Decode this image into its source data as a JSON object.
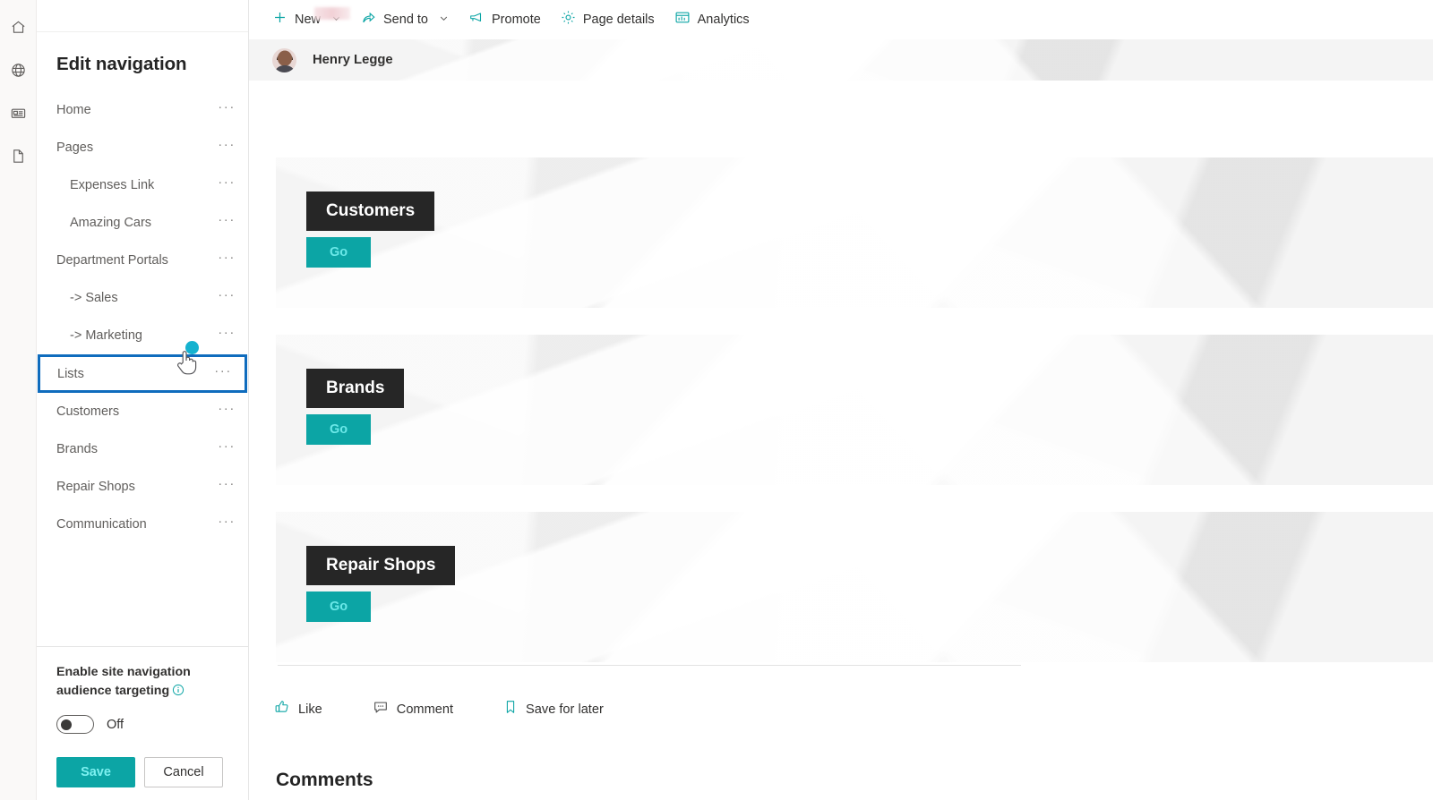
{
  "rail": {
    "items": [
      {
        "icon": "home-icon",
        "name": "home"
      },
      {
        "icon": "globe-icon",
        "name": "globe"
      },
      {
        "icon": "news-icon",
        "name": "news"
      },
      {
        "icon": "document-icon",
        "name": "document"
      }
    ]
  },
  "panel": {
    "title": "Edit navigation",
    "nav_items": [
      {
        "label": "Home",
        "level": 0,
        "selected": false
      },
      {
        "label": "Pages",
        "level": 0,
        "selected": false
      },
      {
        "label": "Expenses Link",
        "level": 1,
        "selected": false
      },
      {
        "label": "Amazing Cars",
        "level": 1,
        "selected": false
      },
      {
        "label": "Department Portals",
        "level": 0,
        "selected": false
      },
      {
        "label": "-> Sales",
        "level": 1,
        "selected": false
      },
      {
        "label": "-> Marketing",
        "level": 1,
        "selected": false
      },
      {
        "label": "Lists",
        "level": 0,
        "selected": true
      },
      {
        "label": "Customers",
        "level": 0,
        "selected": false
      },
      {
        "label": "Brands",
        "level": 0,
        "selected": false
      },
      {
        "label": "Repair Shops",
        "level": 0,
        "selected": false
      },
      {
        "label": "Communication",
        "level": 0,
        "selected": false
      }
    ],
    "overflow_glyph": "···",
    "audience_targeting_label": "Enable site navigation audience targeting",
    "toggle_state": "Off",
    "save_label": "Save",
    "cancel_label": "Cancel",
    "selection_color": "#0f6cbd"
  },
  "toolbar": {
    "items": [
      {
        "label": "New",
        "icon": "plus-icon",
        "has_chevron": true
      },
      {
        "label": "Send to",
        "icon": "share-icon",
        "has_chevron": true
      },
      {
        "label": "Promote",
        "icon": "megaphone-icon",
        "has_chevron": false
      },
      {
        "label": "Page details",
        "icon": "gear-icon",
        "has_chevron": false
      },
      {
        "label": "Analytics",
        "icon": "analytics-icon",
        "has_chevron": false
      }
    ],
    "accent_color": "#0ca5a5"
  },
  "content": {
    "author": "Henry Legge",
    "cards": [
      {
        "title": "Customers",
        "button": "Go"
      },
      {
        "title": "Brands",
        "button": "Go"
      },
      {
        "title": "Repair Shops",
        "button": "Go"
      }
    ],
    "social": [
      {
        "label": "Like",
        "icon": "thumbs-up-icon"
      },
      {
        "label": "Comment",
        "icon": "comment-icon"
      },
      {
        "label": "Save for later",
        "icon": "bookmark-icon"
      }
    ],
    "comments_heading": "Comments"
  }
}
